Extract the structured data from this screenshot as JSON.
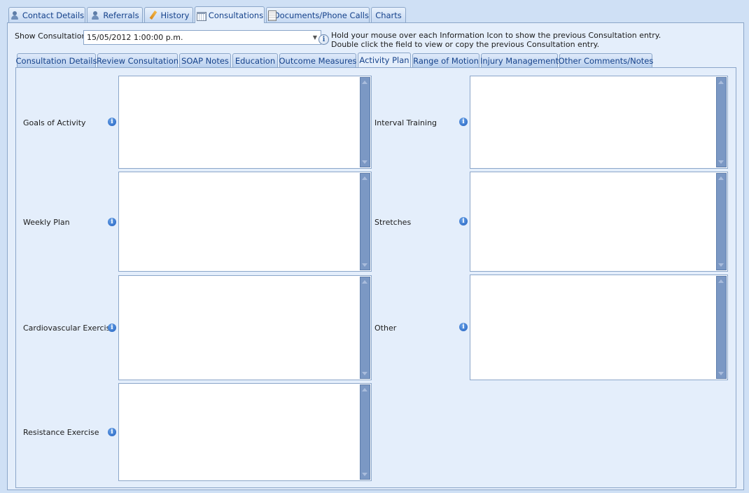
{
  "main_tabs": [
    {
      "label": "Contact Details",
      "icon": "person-icon"
    },
    {
      "label": "Referrals",
      "icon": "person-icon"
    },
    {
      "label": "History",
      "icon": "pencil-icon"
    },
    {
      "label": "Consultations",
      "icon": "calendar-icon"
    },
    {
      "label": "Documents/Phone Calls",
      "icon": "document-icon"
    },
    {
      "label": "Charts",
      "icon": ""
    }
  ],
  "active_main_tab": "Consultations",
  "show_consultation": {
    "label": "Show Consultation:",
    "value": "15/05/2012 1:00:00 p.m."
  },
  "hint": {
    "icon": "info-icon",
    "line1": "Hold your mouse over each Information Icon to show the previous Consultation entry.",
    "line2": "Double click the field to view or copy the previous Consultation entry."
  },
  "sub_tabs": [
    "Consultation Details",
    "Review Consultation",
    "SOAP Notes",
    "Education",
    "Outcome Measures",
    "Activity Plan",
    "Range of Motion",
    "Injury Management",
    "Other Comments/Notes"
  ],
  "active_sub_tab": "Activity Plan",
  "fields": {
    "goals_of_activity": {
      "label": "Goals of Activity",
      "value": ""
    },
    "weekly_plan": {
      "label": "Weekly Plan",
      "value": ""
    },
    "cardiovascular_exercise": {
      "label": "Cardiovascular Exercise",
      "value": ""
    },
    "resistance_exercise": {
      "label": "Resistance Exercise",
      "value": ""
    },
    "interval_training": {
      "label": "Interval Training",
      "value": ""
    },
    "stretches": {
      "label": "Stretches",
      "value": ""
    },
    "other": {
      "label": "Other",
      "value": ""
    }
  },
  "colors": {
    "background": "#cfe0f5",
    "panel": "#e4eefb",
    "border": "#8ba6c9",
    "tab_text": "#15428b",
    "scrollbar": "#7b98c4",
    "info_icon": "#1f5fbf"
  }
}
